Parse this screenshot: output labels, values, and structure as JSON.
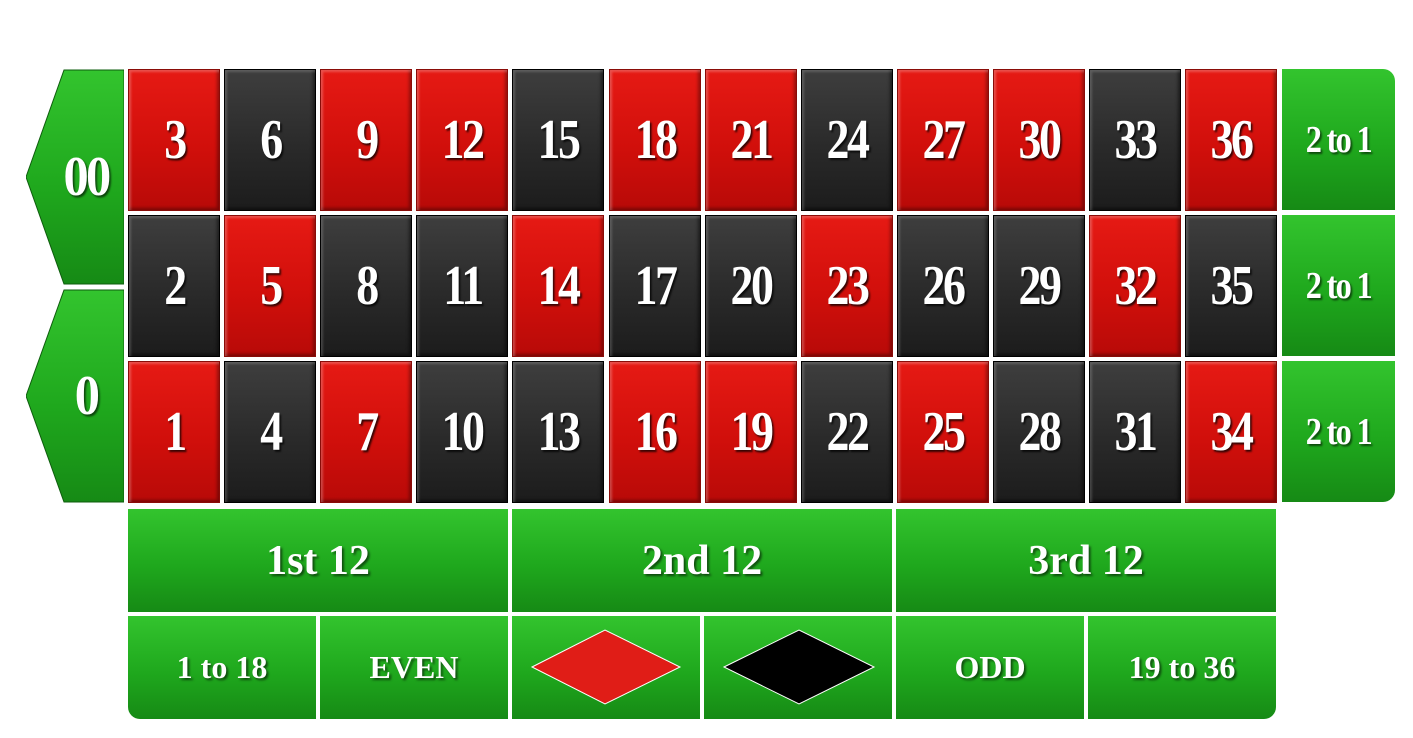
{
  "zeros": [
    "00",
    "0"
  ],
  "numbers": [
    [
      {
        "n": "3",
        "c": "red"
      },
      {
        "n": "6",
        "c": "black"
      },
      {
        "n": "9",
        "c": "red"
      },
      {
        "n": "12",
        "c": "red"
      },
      {
        "n": "15",
        "c": "black"
      },
      {
        "n": "18",
        "c": "red"
      },
      {
        "n": "21",
        "c": "red"
      },
      {
        "n": "24",
        "c": "black"
      },
      {
        "n": "27",
        "c": "red"
      },
      {
        "n": "30",
        "c": "red"
      },
      {
        "n": "33",
        "c": "black"
      },
      {
        "n": "36",
        "c": "red"
      }
    ],
    [
      {
        "n": "2",
        "c": "black"
      },
      {
        "n": "5",
        "c": "red"
      },
      {
        "n": "8",
        "c": "black"
      },
      {
        "n": "11",
        "c": "black"
      },
      {
        "n": "14",
        "c": "red"
      },
      {
        "n": "17",
        "c": "black"
      },
      {
        "n": "20",
        "c": "black"
      },
      {
        "n": "23",
        "c": "red"
      },
      {
        "n": "26",
        "c": "black"
      },
      {
        "n": "29",
        "c": "black"
      },
      {
        "n": "32",
        "c": "red"
      },
      {
        "n": "35",
        "c": "black"
      }
    ],
    [
      {
        "n": "1",
        "c": "red"
      },
      {
        "n": "4",
        "c": "black"
      },
      {
        "n": "7",
        "c": "red"
      },
      {
        "n": "10",
        "c": "black"
      },
      {
        "n": "13",
        "c": "black"
      },
      {
        "n": "16",
        "c": "red"
      },
      {
        "n": "19",
        "c": "red"
      },
      {
        "n": "22",
        "c": "black"
      },
      {
        "n": "25",
        "c": "red"
      },
      {
        "n": "28",
        "c": "black"
      },
      {
        "n": "31",
        "c": "black"
      },
      {
        "n": "34",
        "c": "red"
      }
    ]
  ],
  "columns": [
    "2 to 1",
    "2 to 1",
    "2 to 1"
  ],
  "dozens": [
    "1st  12",
    "2nd  12",
    "3rd  12"
  ],
  "outside": {
    "low": "1 to 18",
    "even": "EVEN",
    "odd": "ODD",
    "high": "19 to 36"
  },
  "colors": {
    "red": "#d10f0b",
    "black": "#2a2a2a",
    "green": "#1fa81d",
    "diamond_red": "#e01d17",
    "diamond_black": "#000000"
  },
  "icons": {
    "red_bet": "red-diamond-icon",
    "black_bet": "black-diamond-icon"
  }
}
